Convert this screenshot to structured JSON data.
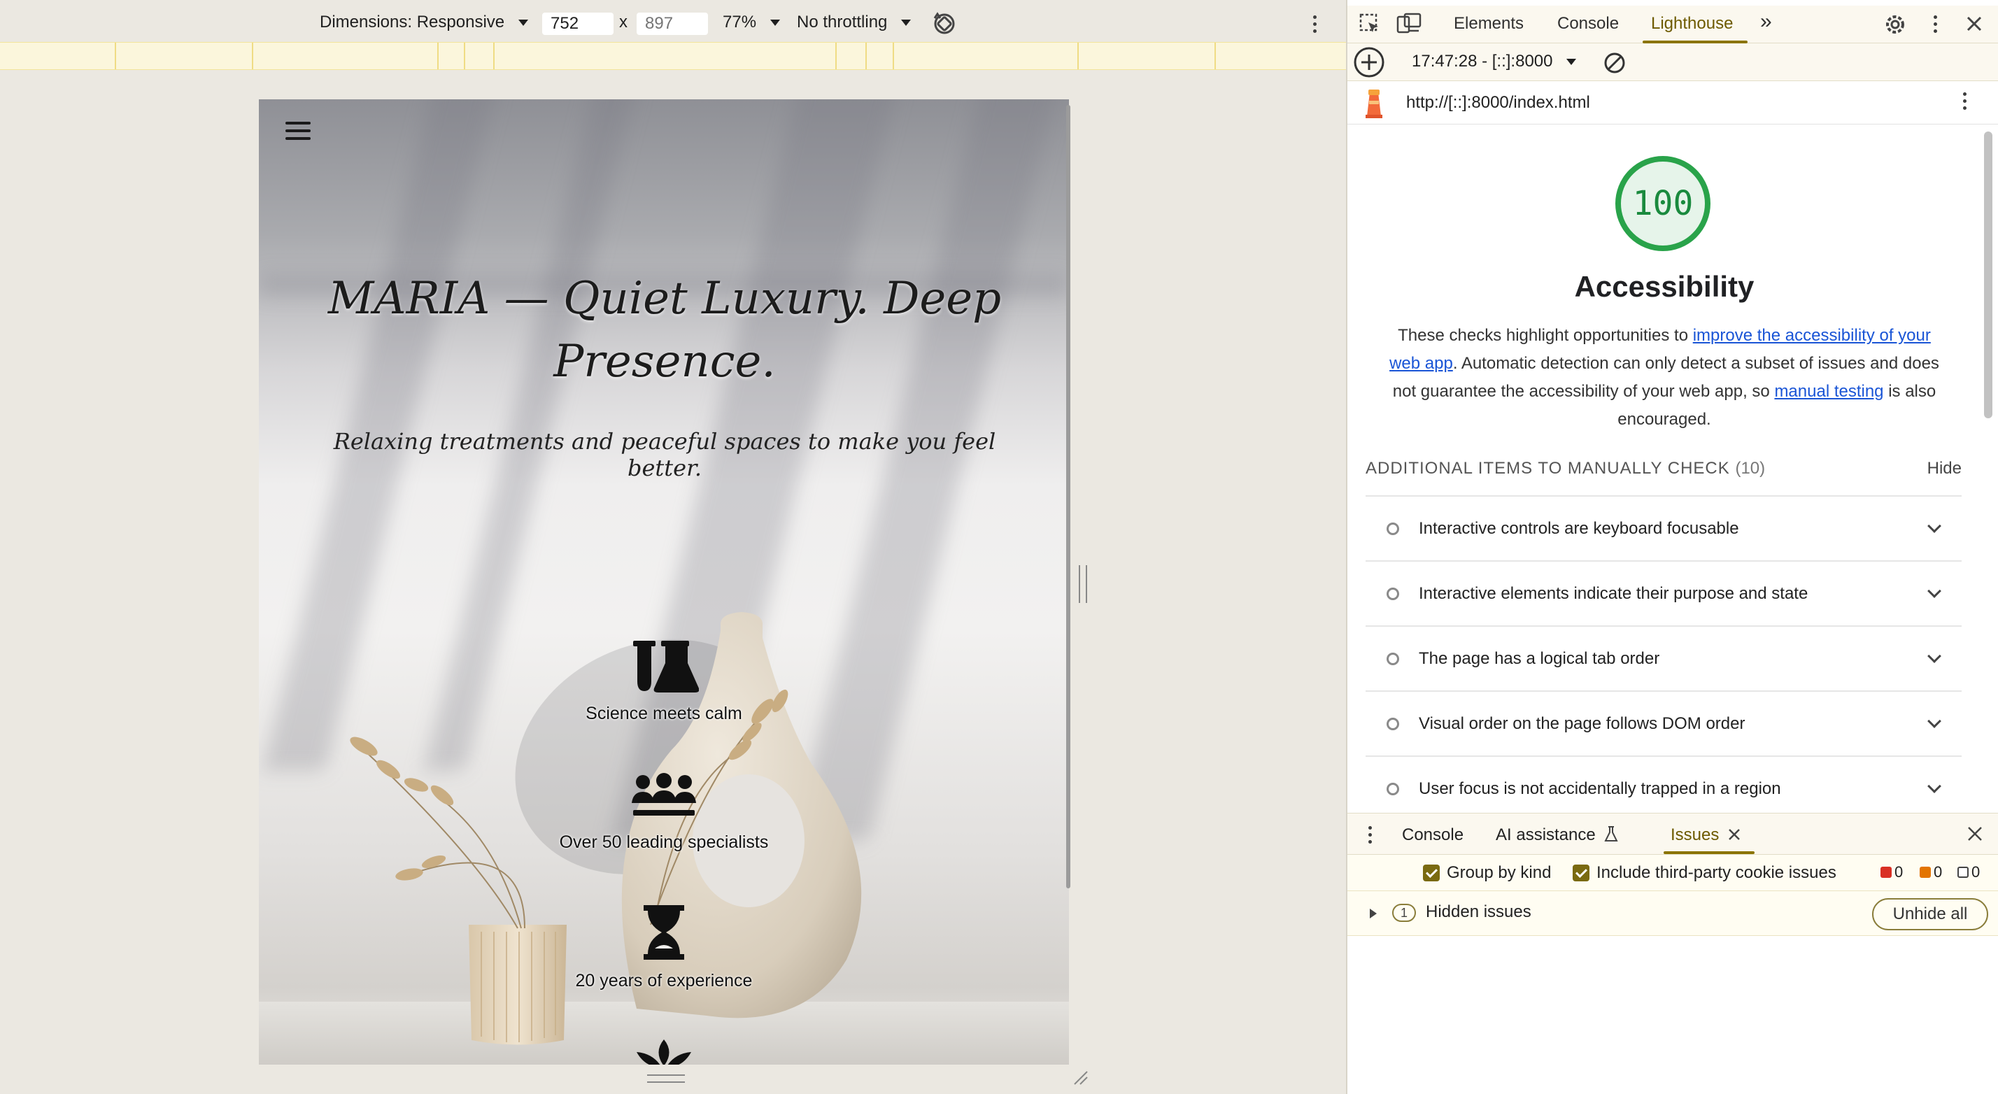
{
  "device_toolbar": {
    "dimensions_label": "Dimensions: Responsive",
    "width_value": "752",
    "height_placeholder": "897",
    "times": "x",
    "zoom": "77%",
    "throttling": "No throttling"
  },
  "page": {
    "hero_title": "MARIA — Quiet Luxury. Deep Presence.",
    "hero_subtitle": "Relaxing treatments and peaceful spaces to make you feel better.",
    "features": [
      {
        "icon": "flask-icon",
        "label": "Science meets calm"
      },
      {
        "icon": "people-icon",
        "label": "Over 50 leading specialists"
      },
      {
        "icon": "hourglass-icon",
        "label": "20 years of experience"
      },
      {
        "icon": "lotus-icon",
        "label": ""
      }
    ]
  },
  "devtools": {
    "tabs": [
      "Elements",
      "Console",
      "Lighthouse"
    ],
    "active_tab": "Lighthouse",
    "more_tabs": "»",
    "report_time": "17:47:28 - [::]:8000",
    "url": "http://[::]:8000/index.html",
    "lighthouse": {
      "score": "100",
      "score_color": "#1a8a3e",
      "category": "Accessibility",
      "description_pre": "These checks highlight opportunities to ",
      "link1": "improve the accessibility of your web app",
      "description_mid": ". Automatic detection can only detect a subset of issues and does not guarantee the accessibility of your web app, so ",
      "link2": "manual testing",
      "description_post": " is also encouraged.",
      "manual_heading": "ADDITIONAL ITEMS TO MANUALLY CHECK",
      "manual_count": "(10)",
      "hide_label": "Hide",
      "audits": [
        "Interactive controls are keyboard focusable",
        "Interactive elements indicate their purpose and state",
        "The page has a logical tab order",
        "Visual order on the page follows DOM order",
        "User focus is not accidentally trapped in a region"
      ]
    },
    "drawer": {
      "tabs": [
        "Console",
        "AI assistance",
        "Issues"
      ],
      "active_tab": "Issues",
      "group_by_kind": "Group by kind",
      "third_party": "Include third-party cookie issues",
      "counts": {
        "errors": "0",
        "warnings": "0",
        "info": "0"
      },
      "hidden_count": "1",
      "hidden_label": "Hidden issues",
      "unhide_label": "Unhide all"
    }
  }
}
